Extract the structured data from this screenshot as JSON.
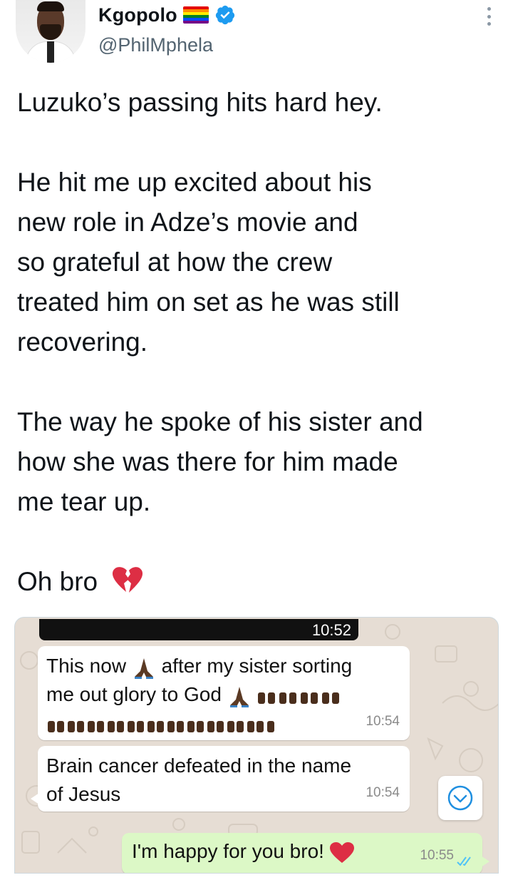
{
  "tweet": {
    "display_name": "Kgopolo",
    "handle": "@PhilMphela",
    "paragraphs": [
      [
        "Luzuko’s passing hits hard hey."
      ],
      [
        "He hit me up excited about his",
        "new role in Adze’s movie and",
        "so grateful at how the crew",
        "treated him on set as he was still",
        "recovering."
      ],
      [
        "The way he spoke of his sister and",
        "how she was there for him made",
        "me tear up."
      ]
    ],
    "closing_text": "Oh bro",
    "closing_emoji": "broken-heart-icon",
    "colors": {
      "text": "#0f1419",
      "handle": "#536471",
      "verified": "#1d9bf0"
    }
  },
  "whatsapp": {
    "top_time": "10:52",
    "messages": [
      {
        "line1_a": "This now",
        "line1_b": "after my sister sorting",
        "line2": "me out  glory to God",
        "time": "10:54",
        "direction": "incoming"
      },
      {
        "line1": "Brain cancer defeated in the name",
        "line2": "of Jesus",
        "time": "10:54",
        "direction": "incoming"
      },
      {
        "text": "I'm happy for you bro!",
        "time": "10:55",
        "direction": "outgoing",
        "status_icon": "double-check-icon"
      }
    ],
    "colors": {
      "background": "#e6ddd4",
      "incoming": "#ffffff",
      "outgoing": "#dcf8c6",
      "ticks": "#4fc3f7"
    }
  }
}
